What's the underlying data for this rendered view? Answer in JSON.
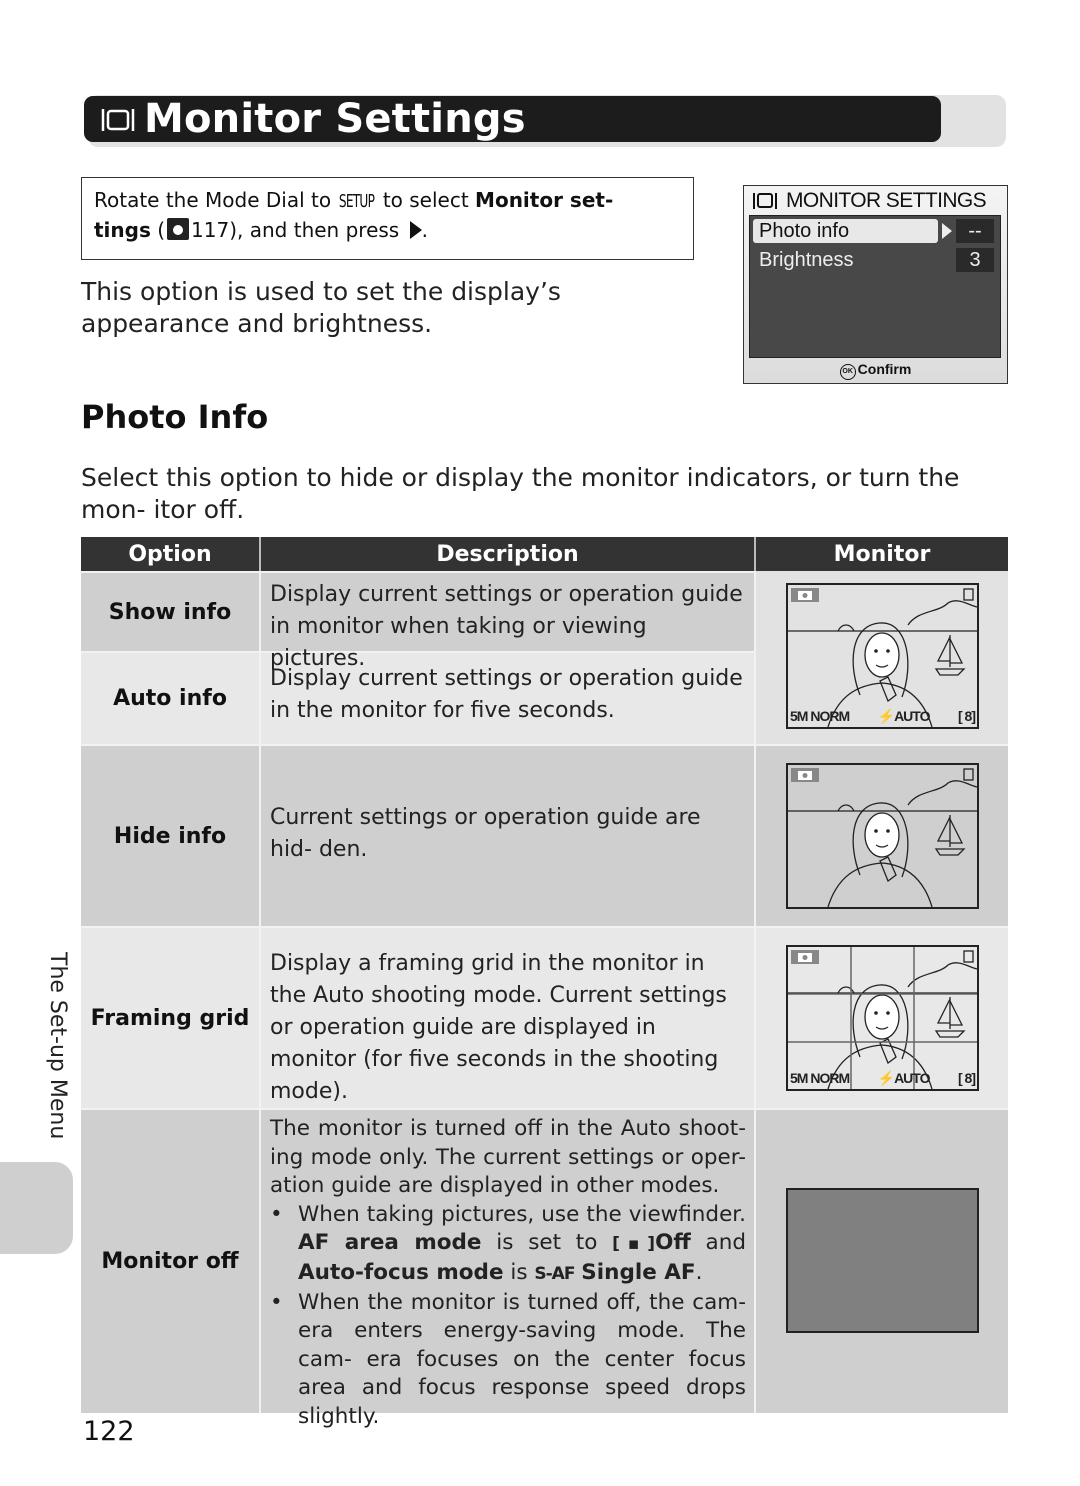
{
  "header": {
    "icon": "monitor-icon",
    "title": "Monitor Settings"
  },
  "instruction": {
    "pre": "Rotate the Mode Dial to ",
    "mode_glyph": "SETUP",
    "mid": " to select ",
    "bold1": "Monitor set-",
    "bold2": "tings",
    "ref_open": " (",
    "ref_icon": "reference-icon",
    "ref_page": "117",
    "post": "), and then press ",
    "arrow": "right-arrow-icon",
    "end": "."
  },
  "intro": "This option is used to set the display’s appearance and brightness.",
  "camera_menu": {
    "title": "MONITOR SETTINGS",
    "items": [
      {
        "label": "Photo info",
        "value": "--",
        "selected": true
      },
      {
        "label": "Brightness",
        "value": "3",
        "selected": false
      }
    ],
    "footer_badge": "OK",
    "footer_label": "Confirm"
  },
  "section": {
    "heading": "Photo Info",
    "text": "Select this option to hide or display the monitor indicators, or turn the mon- itor off."
  },
  "table": {
    "headers": [
      "Option",
      "Description",
      "Monitor"
    ],
    "rows": [
      {
        "option": "Show info",
        "description": "Display current settings or operation guide in monitor when taking or viewing pictures."
      },
      {
        "option": "Auto info",
        "description": "Display current settings or operation guide in the monitor for five seconds."
      },
      {
        "option": "Hide info",
        "description": "Current settings or operation guide are hid- den."
      },
      {
        "option": "Framing grid",
        "description": "Display a framing grid in the monitor in the Auto shooting mode. Current settings or operation guide are displayed in monitor (for five seconds in the shooting mode)."
      },
      {
        "option": "Monitor off",
        "description": "The monitor is turned off in the Auto shoot- ing mode only. The current settings or oper- ation guide are displayed in other modes.",
        "bullet1_text": "When taking pictures, use the viewfinder.",
        "bullet1_b1": "AF area mode",
        "bullet1_m1": " is set to ",
        "bullet1_glyph1": "[▪]",
        "bullet1_b2": "Off",
        "bullet1_m2": " and ",
        "bullet1_b3": "Auto-focus mode",
        "bullet1_m3": " is ",
        "bullet1_glyph2": "S-AF",
        "bullet1_b4": "Single AF",
        "bullet1_end": ".",
        "bullet2": "When the monitor is turned off, the cam- era enters energy-saving mode. The cam- era focuses on the center focus area and focus response speed drops slightly."
      }
    ],
    "lcd_overlay": {
      "mode_icon": "camera-icon",
      "memory_icon": "internal-memory-icon",
      "size": "5M",
      "quality": "NORM",
      "flash": "AUTO",
      "frames": "8"
    }
  },
  "side_tab": {
    "label": "The Set-up Menu"
  },
  "page_number": "122"
}
